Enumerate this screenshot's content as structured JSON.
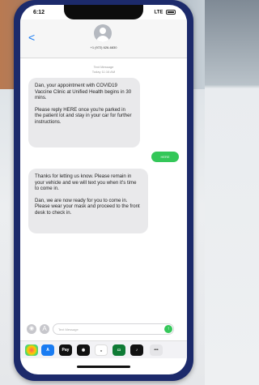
{
  "status_bar": {
    "time": "6:12",
    "signal": "LTE"
  },
  "header": {
    "back_label": "<",
    "phone_number": "+1 (972) 626-6830"
  },
  "thread": {
    "timestamp_line1": "Text Message",
    "timestamp_line2": "Today 11:16 AM",
    "incoming_1": {
      "paragraph_1": "Dan, your appointment with COVID19 Vaccine Clinic at Unified Health begins in 30 mins.",
      "paragraph_2": "Please reply HERE once you're parked in the patient lot and stay in your car for further instructions."
    },
    "outgoing_1": "HERE",
    "incoming_2": {
      "paragraph_1": "Thanks for letting us know. Please remain in your vehicle and we will text you when it's time to come in.",
      "paragraph_2": "Dan, we are now ready for you to come in. Please wear your mask and proceed to the front desk to check in."
    }
  },
  "composer": {
    "placeholder": "Text Message",
    "camera_icon": "camera-icon",
    "appstore_icon": "appstore-icon",
    "send_icon": "send-icon"
  },
  "app_drawer": {
    "items": [
      "Photos",
      "App Store",
      "Pay",
      "Memoji",
      "Stickers",
      "Maps",
      "Music",
      "More"
    ]
  },
  "colors": {
    "phone_frame": "#1c2a6b",
    "incoming_bubble": "#e9e9eb",
    "outgoing_bubble": "#34c759",
    "accent": "#1a7cf2"
  }
}
